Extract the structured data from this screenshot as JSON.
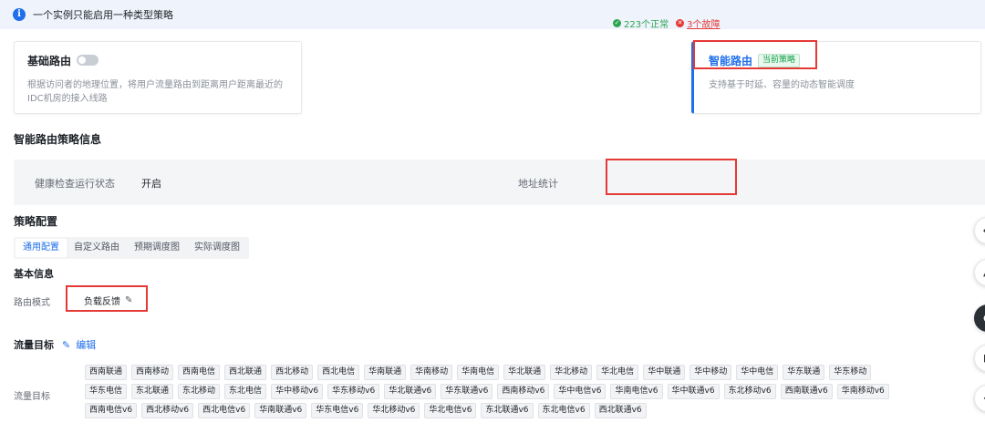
{
  "notice": {
    "text": "一个实例只能启用一种类型策略",
    "icon": "info-circle-icon"
  },
  "basic_route": {
    "title": "基础路由",
    "description": "根据访问者的地理位置，将用户流量路由到距离用户距离最近的IDC机房的接入线路",
    "toggle_on": false
  },
  "smart_route": {
    "title": "智能路由",
    "badge": "当前策略",
    "description": "支持基于时延、容量的动态智能调度"
  },
  "policy_info": {
    "heading": "智能路由策略信息",
    "health_label": "健康检查运行状态",
    "health_value": "开启",
    "addr_label": "地址统计",
    "normal_text": "223个正常",
    "fault_text": "3个故障"
  },
  "policy_config": {
    "heading": "策略配置",
    "tabs": [
      "通用配置",
      "自定义路由",
      "预期调度图",
      "实际调度图"
    ],
    "active_tab": "通用配置"
  },
  "basic_info": {
    "heading": "基本信息",
    "mode_label": "路由模式",
    "mode_value": "负载反馈"
  },
  "traffic_target": {
    "heading": "流量目标",
    "edit_label": "编辑",
    "row_label": "流量目标",
    "tags": [
      [
        "西南联通",
        "西南移动",
        "西南电信",
        "西北联通",
        "西北移动",
        "西北电信",
        "华南联通",
        "华南移动",
        "华南电信",
        "华北联通",
        "华北移动",
        "华北电信",
        "华中联通",
        "华中移动",
        "华中电信",
        "华东联通",
        "华东移动"
      ],
      [
        "华东电信",
        "东北联通",
        "东北移动",
        "东北电信",
        "华中移动v6",
        "华东移动v6",
        "华北联通v6",
        "华东联通v6",
        "西南移动v6",
        "华中电信v6",
        "华南电信v6",
        "华中联通v6",
        "东北移动v6",
        "西南联通v6",
        "华南移动v6"
      ],
      [
        "西南电信v6",
        "西北移动v6",
        "西北电信v6",
        "华南联通v6",
        "华东电信v6",
        "华北移动v6",
        "华北电信v6",
        "东北联通v6",
        "东北电信v6",
        "西北联通v6"
      ]
    ]
  },
  "colors": {
    "accent": "#1f6feb",
    "ok": "#2da44e",
    "error": "#e53935",
    "highlight": "#e53935"
  }
}
